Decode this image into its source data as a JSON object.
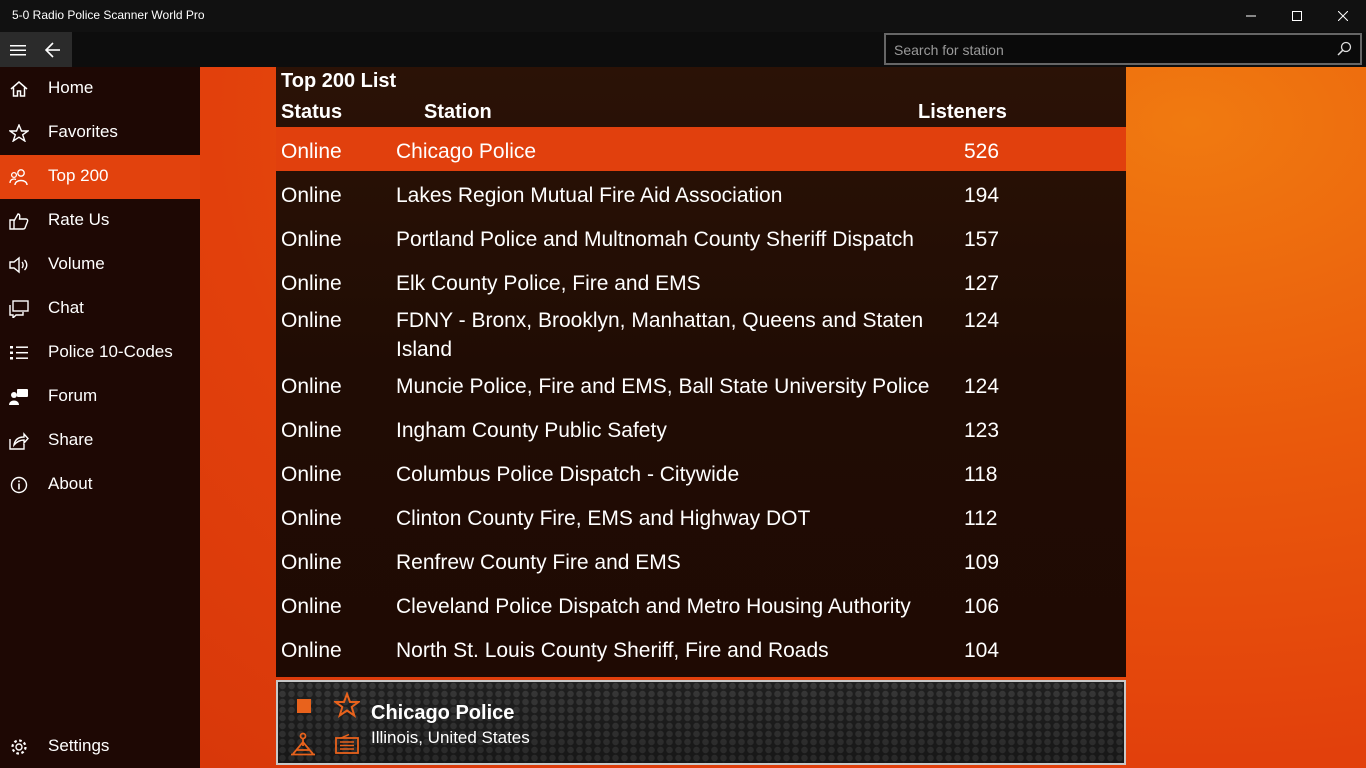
{
  "window": {
    "title": "5-0 Radio Police Scanner World Pro"
  },
  "search": {
    "placeholder": "Search for station"
  },
  "sidebar": {
    "items": [
      {
        "label": "Home",
        "icon": "home-icon"
      },
      {
        "label": "Favorites",
        "icon": "favorites-icon"
      },
      {
        "label": "Top 200",
        "icon": "people-icon",
        "active": true
      },
      {
        "label": "Rate Us",
        "icon": "thumbs-up-icon"
      },
      {
        "label": "Volume",
        "icon": "volume-icon"
      },
      {
        "label": "Chat",
        "icon": "chat-icon"
      },
      {
        "label": "Police 10-Codes",
        "icon": "list-icon"
      },
      {
        "label": "Forum",
        "icon": "forum-icon"
      },
      {
        "label": "Share",
        "icon": "share-icon"
      },
      {
        "label": "About",
        "icon": "info-icon"
      }
    ],
    "settings_label": "Settings"
  },
  "list": {
    "title": "Top 200 List",
    "headers": {
      "status": "Status",
      "station": "Station",
      "listeners": "Listeners"
    },
    "rows": [
      {
        "status": "Online",
        "station": "Chicago Police",
        "listeners": "526"
      },
      {
        "status": "Online",
        "station": "Lakes Region Mutual Fire Aid Association",
        "listeners": "194"
      },
      {
        "status": "Online",
        "station": "Portland Police and Multnomah County Sheriff Dispatch",
        "listeners": "157"
      },
      {
        "status": "Online",
        "station": "Elk County Police, Fire and EMS",
        "listeners": "127"
      },
      {
        "status": "Online",
        "station": "FDNY - Bronx, Brooklyn, Manhattan, Queens and Staten Island",
        "listeners": "124"
      },
      {
        "status": "Online",
        "station": "Muncie Police, Fire and EMS, Ball State University Police",
        "listeners": "124"
      },
      {
        "status": "Online",
        "station": "Ingham County Public Safety",
        "listeners": "123"
      },
      {
        "status": "Online",
        "station": "Columbus Police Dispatch - Citywide",
        "listeners": "118"
      },
      {
        "status": "Online",
        "station": "Clinton County Fire, EMS and Highway DOT",
        "listeners": "112"
      },
      {
        "status": "Online",
        "station": "Renfrew County Fire and EMS",
        "listeners": "109"
      },
      {
        "status": "Online",
        "station": "Cleveland Police Dispatch and Metro Housing Authority",
        "listeners": "106"
      },
      {
        "status": "Online",
        "station": "North St. Louis County Sheriff, Fire and Roads",
        "listeners": "104"
      }
    ]
  },
  "player": {
    "station": "Chicago Police",
    "location": "Illinois, United States"
  },
  "colors": {
    "accent": "#e2420d",
    "sidebar_bg": "#1e0804",
    "icon_orange": "#e8621c"
  }
}
